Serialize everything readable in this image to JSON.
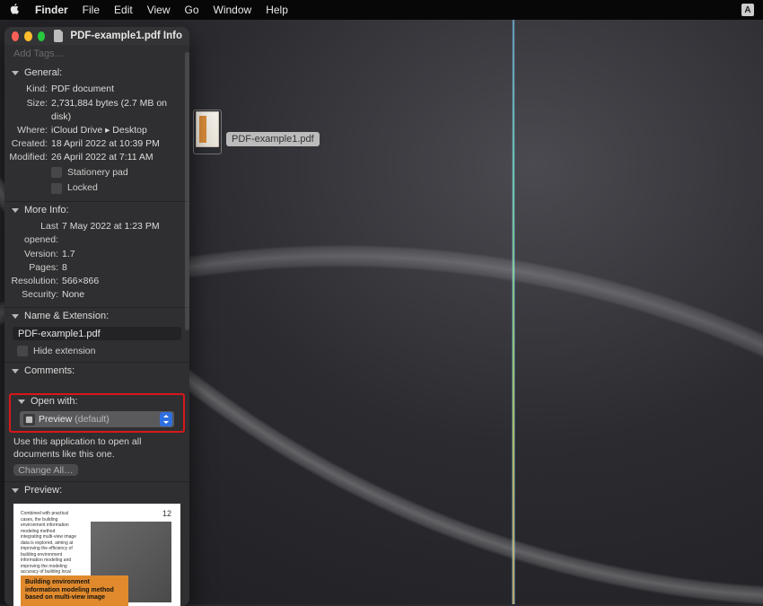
{
  "menubar": {
    "app": "Finder",
    "items": [
      "File",
      "Edit",
      "View",
      "Go",
      "Window",
      "Help"
    ],
    "right_badge": "A"
  },
  "desktop_file": {
    "label": "PDF-example1.pdf"
  },
  "info_window": {
    "title": "PDF-example1.pdf Info",
    "add_tags_placeholder": "Add Tags…",
    "general": {
      "header": "General:",
      "kind_label": "Kind:",
      "kind": "PDF document",
      "size_label": "Size:",
      "size": "2,731,884 bytes (2.7 MB on disk)",
      "where_label": "Where:",
      "where": "iCloud Drive ▸ Desktop",
      "created_label": "Created:",
      "created": "18 April 2022 at 10:39 PM",
      "modified_label": "Modified:",
      "modified": "26 April 2022 at 7:11 AM",
      "stationery_pad": "Stationery pad",
      "locked": "Locked"
    },
    "more_info": {
      "header": "More Info:",
      "last_opened_label": "Last opened:",
      "last_opened": "7 May 2022 at 1:23 PM",
      "version_label": "Version:",
      "version": "1.7",
      "pages_label": "Pages:",
      "pages": "8",
      "resolution_label": "Resolution:",
      "resolution": "566×866",
      "security_label": "Security:",
      "security": "None"
    },
    "name_ext": {
      "header": "Name & Extension:",
      "filename": "PDF-example1.pdf",
      "hide_ext": "Hide extension"
    },
    "comments": {
      "header": "Comments:"
    },
    "open_with": {
      "header": "Open with:",
      "app_name": "Preview",
      "default_suffix": "(default)",
      "helper": "Use this application to open all documents like this one.",
      "change_all": "Change All…"
    },
    "preview": {
      "header": "Preview:",
      "page_num": "12",
      "body_text": "Combined with practical cases, the building environment information modeling method integrating multi-view image data is explored, aiming at improving the efficiency of building environment information modeling and improving the modeling accuracy of building local information such as the facet of eaves, and improving the technical route of multi-view image data.",
      "band_text": "Building environment information modeling method based on multi-view image"
    }
  }
}
